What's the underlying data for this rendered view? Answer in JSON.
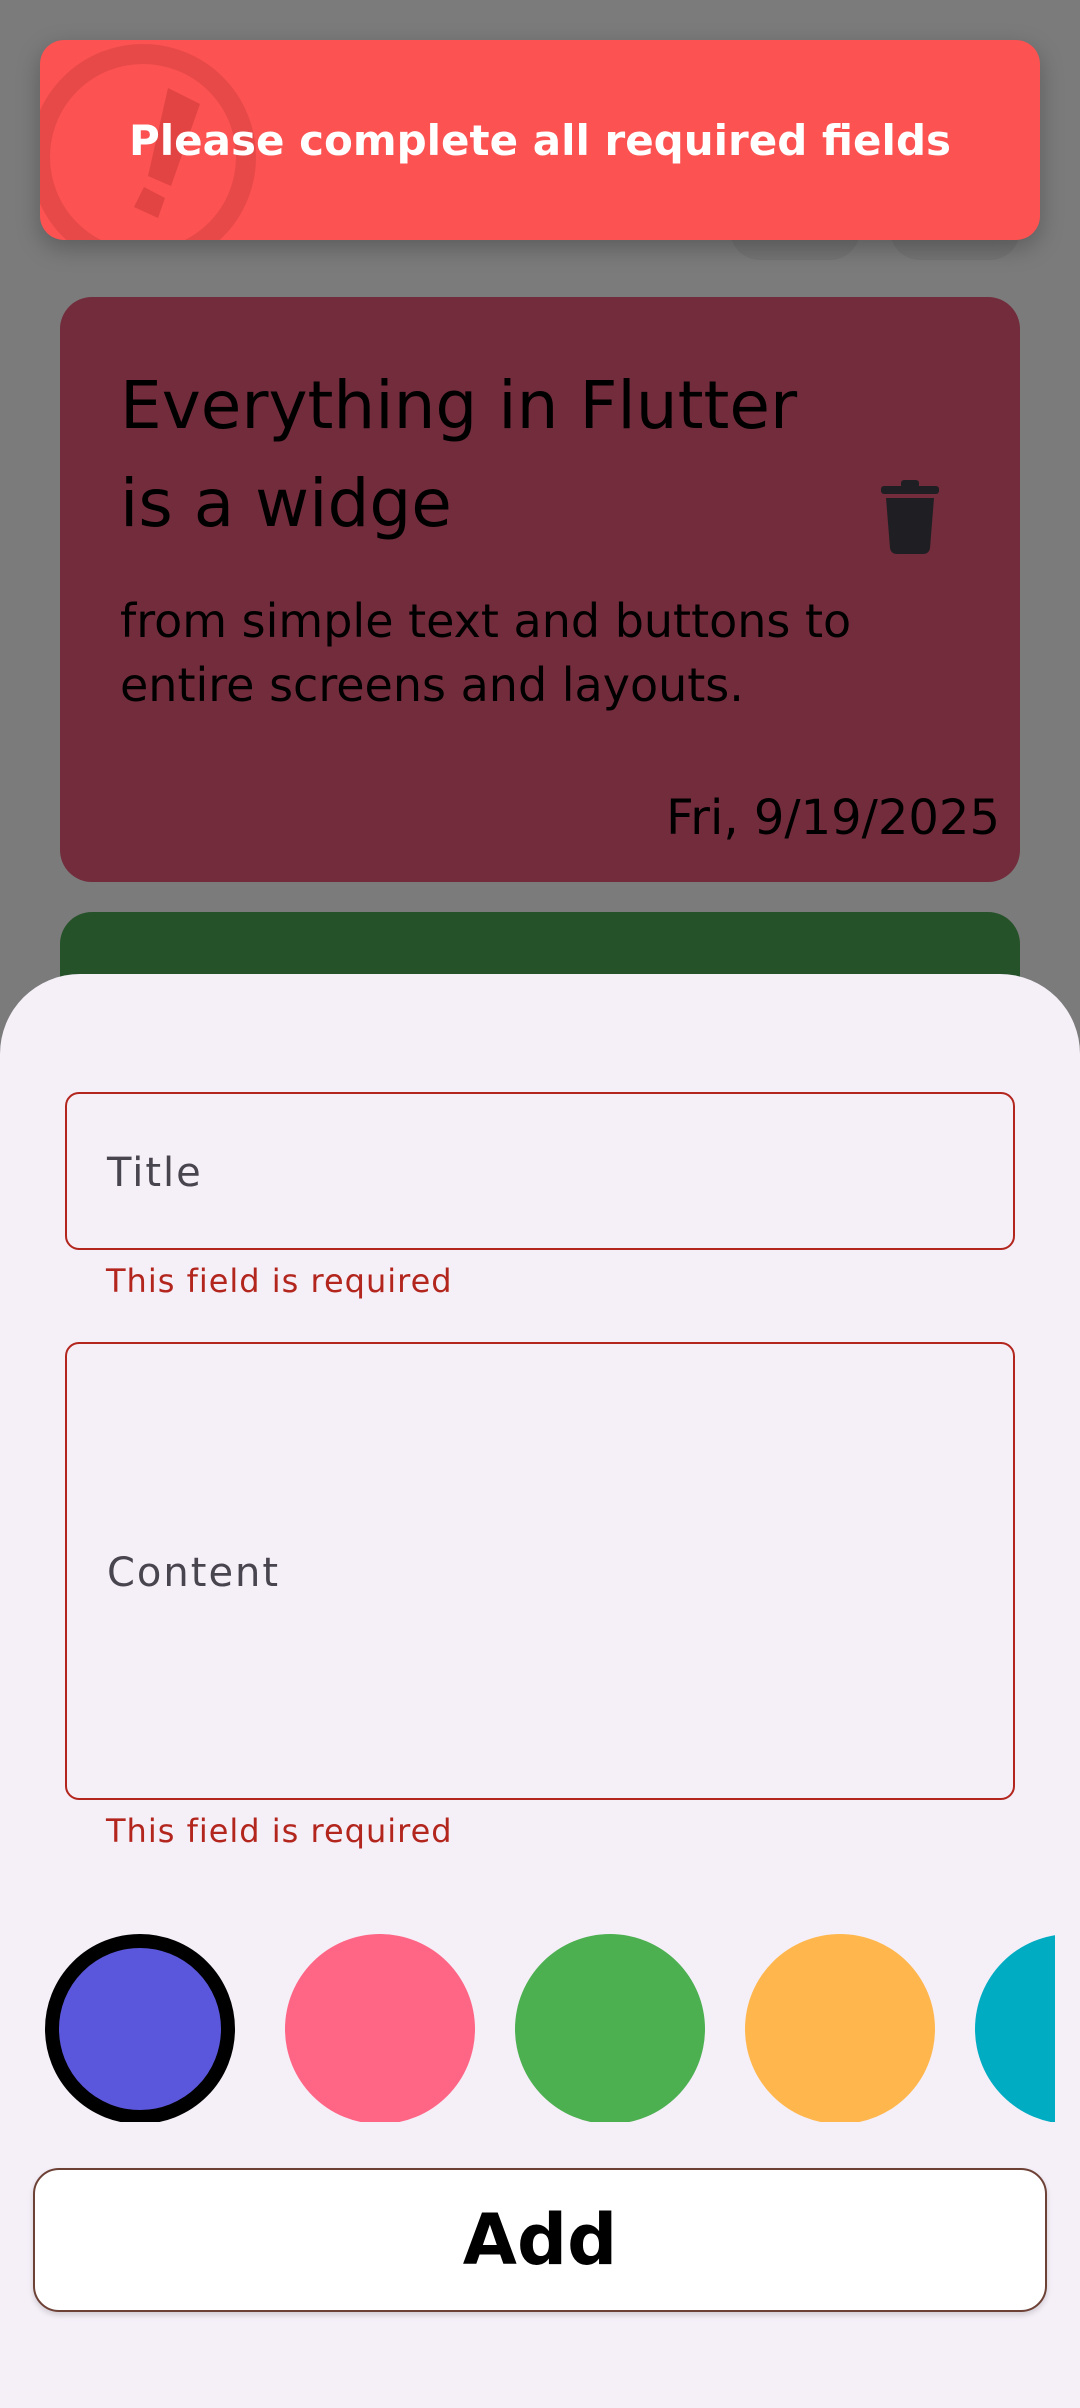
{
  "snackbar": {
    "message": "Please complete all required fields",
    "icon": "warning-icon",
    "color": "#fc5252"
  },
  "notes": [
    {
      "title": "Everything in Flutter is a widge",
      "content": "from simple text and buttons to entire screens and layouts.",
      "date": "Fri, 9/19/2025",
      "color": "#722c3c",
      "delete_icon": "trash-icon"
    },
    {
      "color": "#26522a"
    }
  ],
  "form": {
    "title_placeholder": "Title",
    "title_error": "This field is required",
    "content_placeholder": "Content",
    "content_error": "This field is required"
  },
  "colors": [
    {
      "hex": "#5b57dc",
      "selected": true
    },
    {
      "hex": "#ff6585",
      "selected": false
    },
    {
      "hex": "#4caf50",
      "selected": false
    },
    {
      "hex": "#ffb74d",
      "selected": false
    },
    {
      "hex": "#00acc1",
      "selected": false
    }
  ],
  "add_button": {
    "label": "Add"
  }
}
